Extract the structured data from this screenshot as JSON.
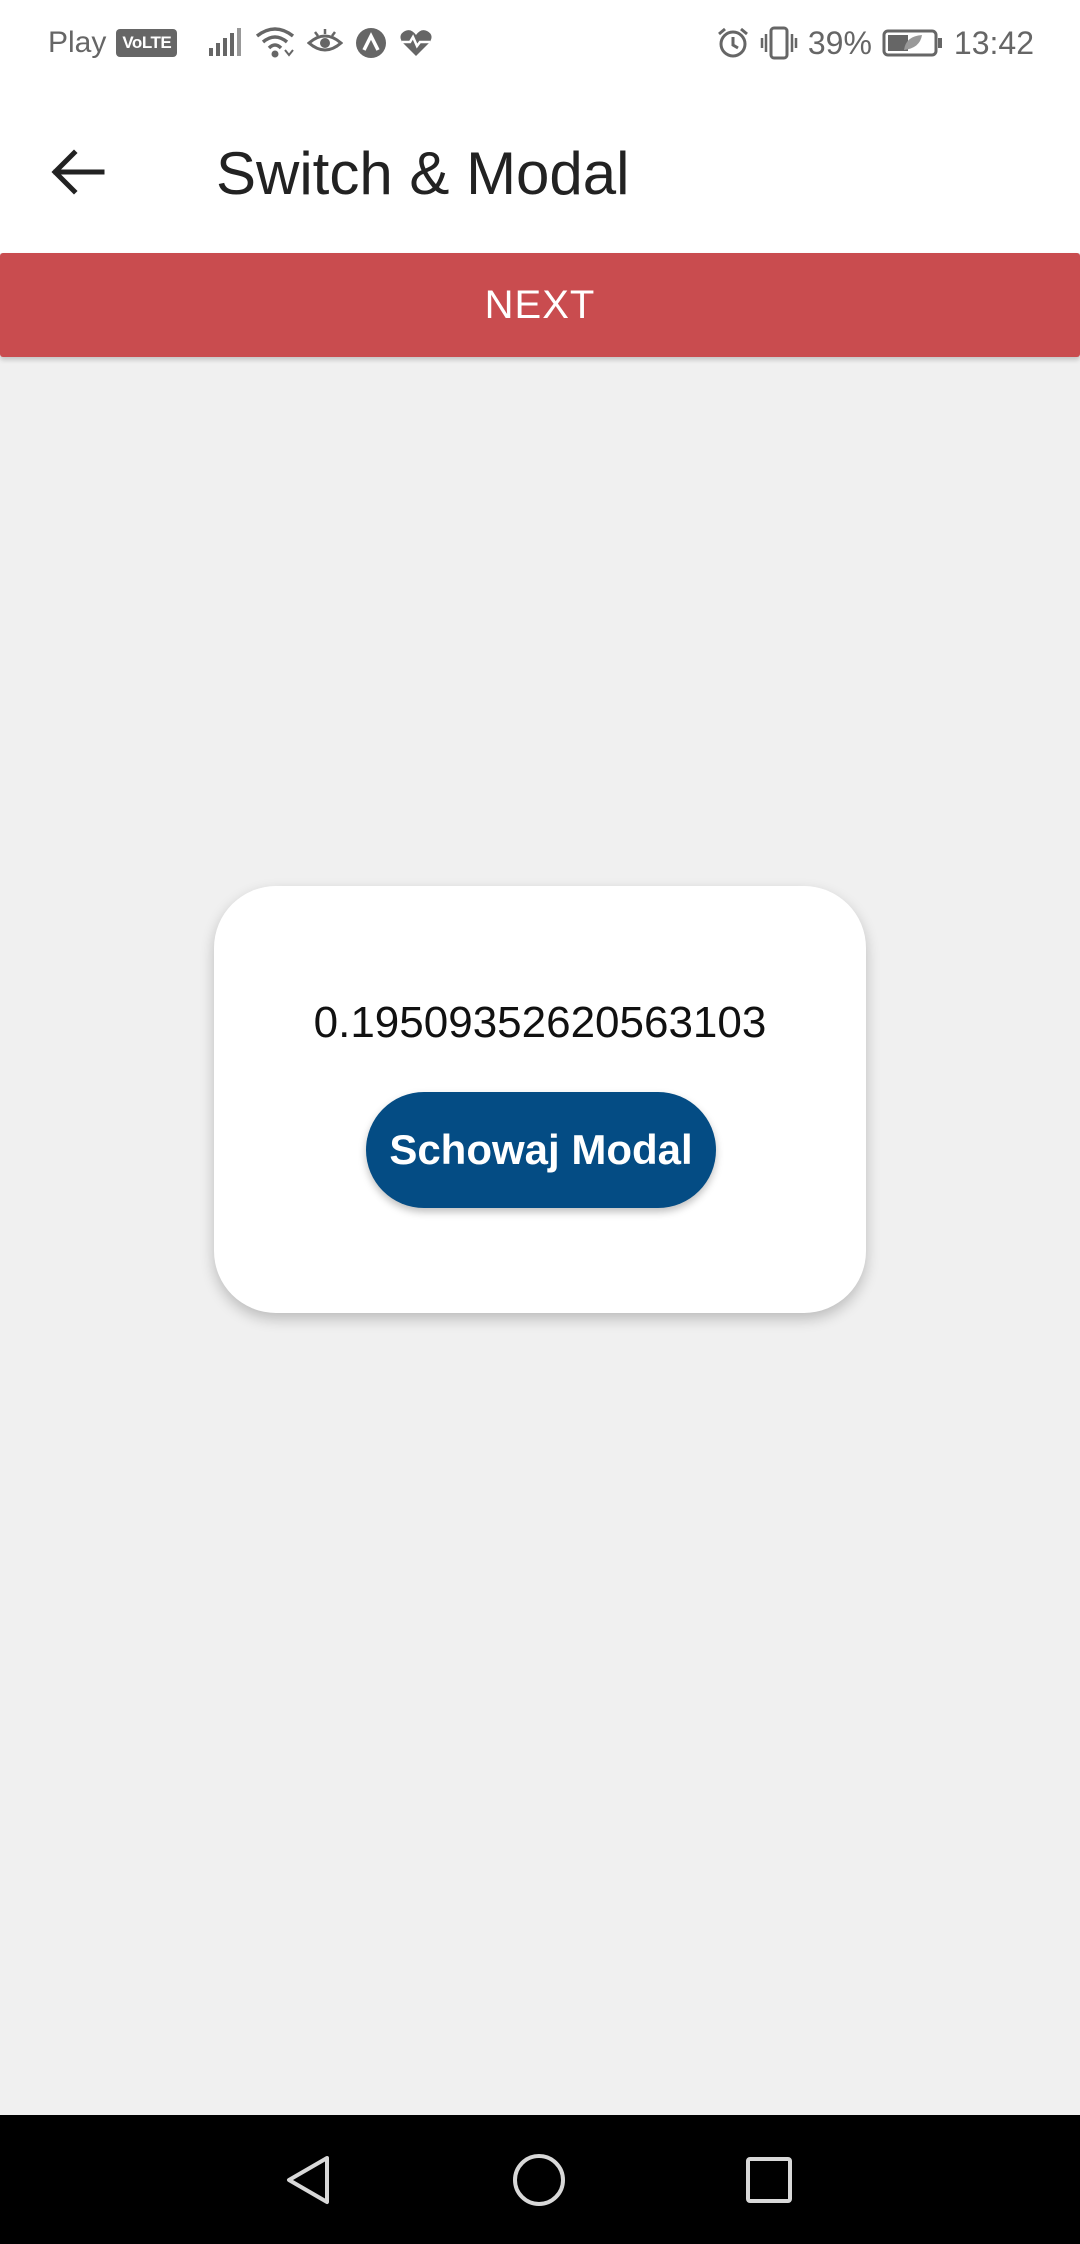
{
  "status_bar": {
    "carrier": "Play",
    "volte_badge": "VoLTE",
    "battery_percent": "39%",
    "time": "13:42",
    "icons": [
      "signal-icon",
      "wifi-icon",
      "eye-icon",
      "app-icon",
      "heart-pulse-icon",
      "alarm-icon",
      "vibrate-icon",
      "battery-icon"
    ]
  },
  "app_bar": {
    "title": "Switch & Modal"
  },
  "next_button": {
    "label": "NEXT",
    "color": "#c94c4f"
  },
  "modal": {
    "value": "0.19509352620563103",
    "button_label": "Schowaj Modal",
    "button_color": "#044c84"
  },
  "nav_bar": {
    "items": [
      "back-icon",
      "home-icon",
      "recents-icon"
    ]
  }
}
